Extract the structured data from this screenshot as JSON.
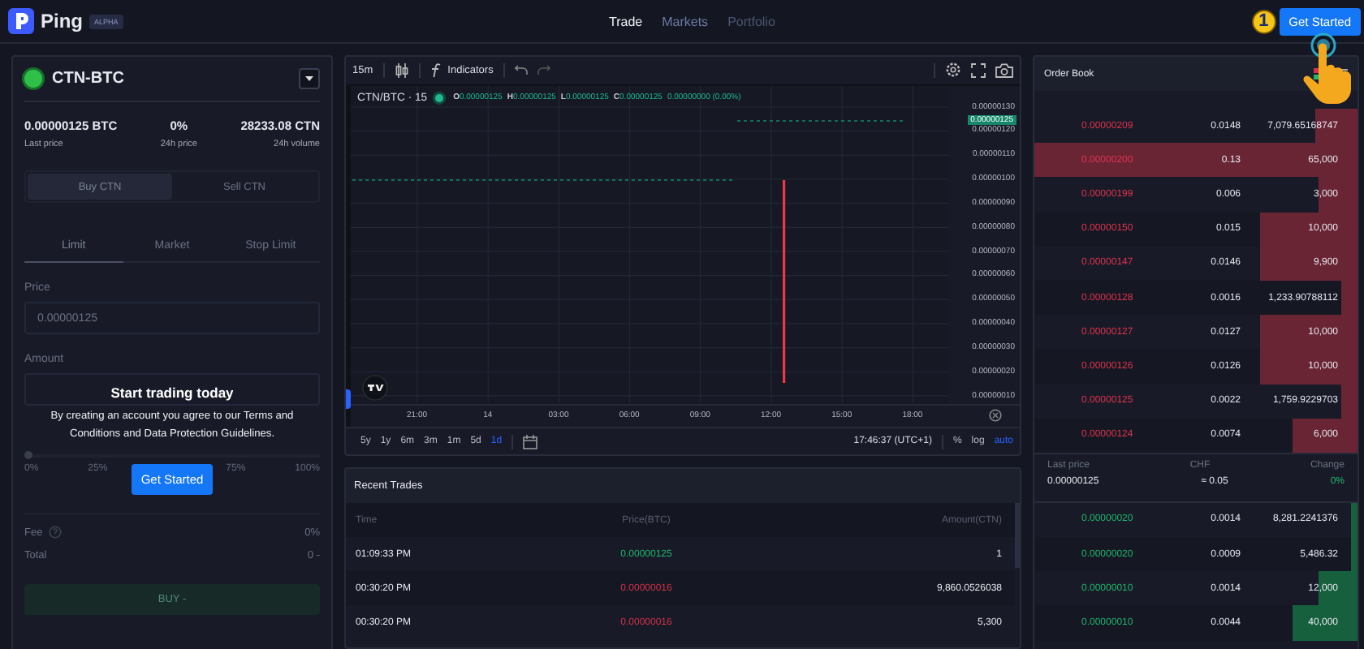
{
  "header": {
    "logo_text": "Ping",
    "badge": "ALPHA",
    "nav": [
      {
        "label": "Trade",
        "selected": true,
        "disabled": false
      },
      {
        "label": "Markets",
        "selected": false,
        "disabled": false
      },
      {
        "label": "Portfolio",
        "selected": false,
        "disabled": true
      }
    ],
    "cta": "Get Started",
    "tutorial_step": "1"
  },
  "pair": {
    "name": "CTN-BTC",
    "stats": [
      {
        "value": "0.00000125 BTC",
        "label": "Last price"
      },
      {
        "value": "0%",
        "label": "24h price"
      },
      {
        "value": "28233.08 CTN",
        "label": "24h volume"
      }
    ]
  },
  "order_form": {
    "sides": [
      {
        "label": "Buy CTN",
        "selected": true
      },
      {
        "label": "Sell CTN",
        "selected": false
      }
    ],
    "order_types": [
      {
        "label": "Limit",
        "selected": true
      },
      {
        "label": "Market",
        "selected": false
      },
      {
        "label": "Stop Limit",
        "selected": false
      }
    ],
    "price_label": "Price",
    "price_value": "0.00000125",
    "amount_label": "Amount",
    "slider": {
      "level": 0,
      "marks": [
        "0%",
        "25%",
        "75%",
        "100%"
      ]
    },
    "fee_label": "Fee",
    "fee_value": "0%",
    "total_label": "Total",
    "total_value": "0 -",
    "submit": "BUY -"
  },
  "signup_prompt": {
    "title": "Start trading today",
    "text": "By creating an account you agree to our Terms and Conditions and Data Protection Guidelines.",
    "button": "Get Started"
  },
  "chart": {
    "interval": "15m",
    "indicators_label": "Indicators",
    "legend": {
      "symbol": "CTN/BTC · 15",
      "ohlc": [
        {
          "key": "O",
          "value": "0.00000125"
        },
        {
          "key": "H",
          "value": "0.00000125"
        },
        {
          "key": "L",
          "value": "0.00000125"
        },
        {
          "key": "C",
          "value": "0.00000125"
        }
      ],
      "change": "0.00000000 (0.00%)"
    },
    "price_labels": [
      "0.00000130",
      "0.00000120",
      "0.00000110",
      "0.00000100",
      "0.00000090",
      "0.00000080",
      "0.00000070",
      "0.00000060",
      "0.00000050",
      "0.00000040",
      "0.00000030",
      "0.00000020",
      "0.00000010"
    ],
    "last_price_tag": "0.00000125",
    "time_labels": [
      "21:00",
      "14",
      "03:00",
      "06:00",
      "09:00",
      "12:00",
      "15:00",
      "18:00"
    ],
    "ranges": [
      {
        "label": "5y",
        "selected": false
      },
      {
        "label": "1y",
        "selected": false
      },
      {
        "label": "6m",
        "selected": false
      },
      {
        "label": "3m",
        "selected": false
      },
      {
        "label": "1m",
        "selected": false
      },
      {
        "label": "5d",
        "selected": false
      },
      {
        "label": "1d",
        "selected": true
      }
    ],
    "clock": "17:46:37 (UTC+1)",
    "scale_options": [
      {
        "label": "%",
        "selected": false
      },
      {
        "label": "log",
        "selected": false
      },
      {
        "label": "auto",
        "selected": true
      }
    ]
  },
  "recent_trades": {
    "title": "Recent Trades",
    "columns": [
      "Time",
      "Price(BTC)",
      "Amount(CTN)"
    ],
    "rows": [
      {
        "time": "01:09:33 PM",
        "price": "0.00000125",
        "amount": "1",
        "color": "#1fb86e"
      },
      {
        "time": "00:30:20 PM",
        "price": "0.00000016",
        "amount": "9,860.0526038",
        "color": "#d8304a"
      },
      {
        "time": "00:30:20 PM",
        "price": "0.00000016",
        "amount": "5,300",
        "color": "#d8304a"
      }
    ]
  },
  "order_book": {
    "title": "Order Book",
    "asks": [
      {
        "price": "0.00000209",
        "amount": "0.0148",
        "total": "7,079.65168747",
        "level": 0.13,
        "highlighted": false
      },
      {
        "price": "0.00000200",
        "amount": "0.13",
        "total": "65,000",
        "level": 1,
        "highlighted": true
      },
      {
        "price": "0.00000199",
        "amount": "0.006",
        "total": "3,000",
        "level": 0.12,
        "highlighted": false
      },
      {
        "price": "0.00000150",
        "amount": "0.015",
        "total": "10,000",
        "level": 0.3,
        "highlighted": false
      },
      {
        "price": "0.00000147",
        "amount": "0.0146",
        "total": "9,900",
        "level": 0.3,
        "highlighted": false
      },
      {
        "price": "0.00000128",
        "amount": "0.0016",
        "total": "1,233.90788112",
        "level": 0.05,
        "highlighted": false
      },
      {
        "price": "0.00000127",
        "amount": "0.0127",
        "total": "10,000",
        "level": 0.3,
        "highlighted": false
      },
      {
        "price": "0.00000126",
        "amount": "0.0126",
        "total": "10,000",
        "level": 0.3,
        "highlighted": false
      },
      {
        "price": "0.00000125",
        "amount": "0.0022",
        "total": "1,759.9229703",
        "level": 0.05,
        "highlighted": false
      },
      {
        "price": "0.00000124",
        "amount": "0.0074",
        "total": "6,000",
        "level": 0.2,
        "highlighted": false
      }
    ],
    "summary": {
      "labels": [
        "Last price",
        "CHF",
        "Change"
      ],
      "values": [
        "0.00000125",
        "≈ 0.05",
        "0%"
      ]
    },
    "bids": [
      {
        "price": "0.00000020",
        "amount": "0.0014",
        "total": "8,281.2241376",
        "level": 0.02
      },
      {
        "price": "0.00000020",
        "amount": "0.0009",
        "total": "5,486.32",
        "level": 0.02
      },
      {
        "price": "0.00000010",
        "amount": "0.0014",
        "total": "12,000",
        "level": 0.12
      },
      {
        "price": "0.00000010",
        "amount": "0.0044",
        "total": "40,000",
        "level": 0.2
      }
    ]
  }
}
